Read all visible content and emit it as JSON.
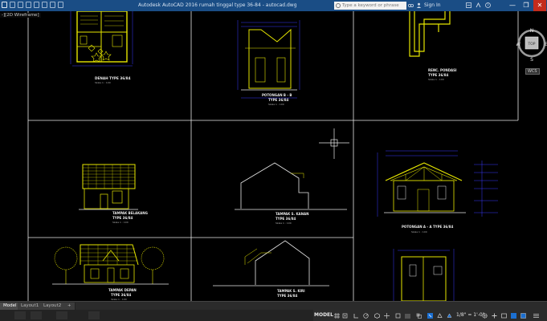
{
  "window": {
    "title": "Autodesk AutoCAD 2016    rumah tinggal type 36-84 - autocad.dwg",
    "search_placeholder": "Type a keyword or phrase",
    "sign_in": "Sign In",
    "minimize": "—",
    "maximize": "❐",
    "close": "✕"
  },
  "viewport": {
    "label": "-][2D Wireframe]"
  },
  "drawing": {
    "labels": {
      "denah_title": "DENAH TYPE 36/84",
      "denah_scale": "Skala 1 : 100",
      "pot_bb_1": "POTONGAN B - B",
      "pot_bb_2": "TYPE 36/84",
      "pot_bb_scale": "Skala 1 : 100",
      "pondasi_1": "RENC. PONDASI",
      "pondasi_2": "TYPE 36/84",
      "pondasi_scale": "Skala 1 : 100",
      "belakang_1": "TAMPAK BELAKANG",
      "belakang_2": "TYPE 36/84",
      "belakang_scale": "Skala 1 : 100",
      "kanan_1": "TAMPAK S. KANAN",
      "kanan_2": "TYPE 36/84",
      "kanan_scale": "Skala 1 : 100",
      "pot_aa": "POTONGAN A - A  TYPE 36/84",
      "pot_aa_scale": "Skala 1 : 100",
      "depan_1": "TAMPAK DEPAN",
      "depan_2": "TYPE 36/84",
      "depan_scale": "Skala 1 : 100",
      "kiri_1": "TAMPAK S. KIRI",
      "kiri_2": "TYPE 36/84",
      "kiri_scale": "Skala 1 : 100"
    }
  },
  "navcube": {
    "face": "TOP",
    "north": "N",
    "south": "S",
    "east": "E",
    "west": "W",
    "wcs": "WCS"
  },
  "tabs": [
    {
      "label": "Model"
    },
    {
      "label": "Layout1"
    },
    {
      "label": "Layout2"
    },
    {
      "label": "+"
    }
  ],
  "status": {
    "model": "MODEL",
    "scale": "1/8\" = 1'-0\""
  },
  "colors": {
    "accent_yellow": "#e6e600",
    "dim_blue": "#3a3aff",
    "titlebar": "#1a4d85"
  }
}
